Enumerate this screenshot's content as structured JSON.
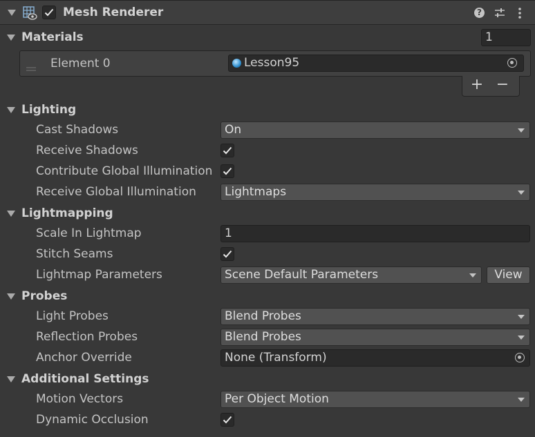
{
  "component": {
    "title": "Mesh Renderer"
  },
  "materials": {
    "label": "Materials",
    "size": "1",
    "element_label": "Element 0",
    "element_value": "Lesson95",
    "add": "+",
    "remove": "−"
  },
  "lighting": {
    "label": "Lighting",
    "cast_shadows": {
      "label": "Cast Shadows",
      "value": "On"
    },
    "receive_shadows": {
      "label": "Receive Shadows",
      "checked": true
    },
    "contribute_gi": {
      "label": "Contribute Global Illumination",
      "checked": true
    },
    "receive_gi": {
      "label": "Receive Global Illumination",
      "value": "Lightmaps"
    }
  },
  "lightmapping": {
    "label": "Lightmapping",
    "scale": {
      "label": "Scale In Lightmap",
      "value": "1"
    },
    "stitch": {
      "label": "Stitch Seams",
      "checked": true
    },
    "params": {
      "label": "Lightmap Parameters",
      "value": "Scene Default Parameters",
      "button": "View"
    }
  },
  "probes": {
    "label": "Probes",
    "light": {
      "label": "Light Probes",
      "value": "Blend Probes"
    },
    "reflection": {
      "label": "Reflection Probes",
      "value": "Blend Probes"
    },
    "anchor": {
      "label": "Anchor Override",
      "value": "None (Transform)"
    }
  },
  "additional": {
    "label": "Additional Settings",
    "motion": {
      "label": "Motion Vectors",
      "value": "Per Object Motion"
    },
    "occlusion": {
      "label": "Dynamic Occlusion",
      "checked": true
    }
  },
  "icons": [
    "mesh-renderer-icon",
    "help-icon",
    "preset-icon",
    "kebab-menu-icon",
    "checkmark-icon",
    "object-picker-icon",
    "material-icon",
    "drag-handle-icon",
    "foldout-icon",
    "dropdown-arrow-icon"
  ]
}
